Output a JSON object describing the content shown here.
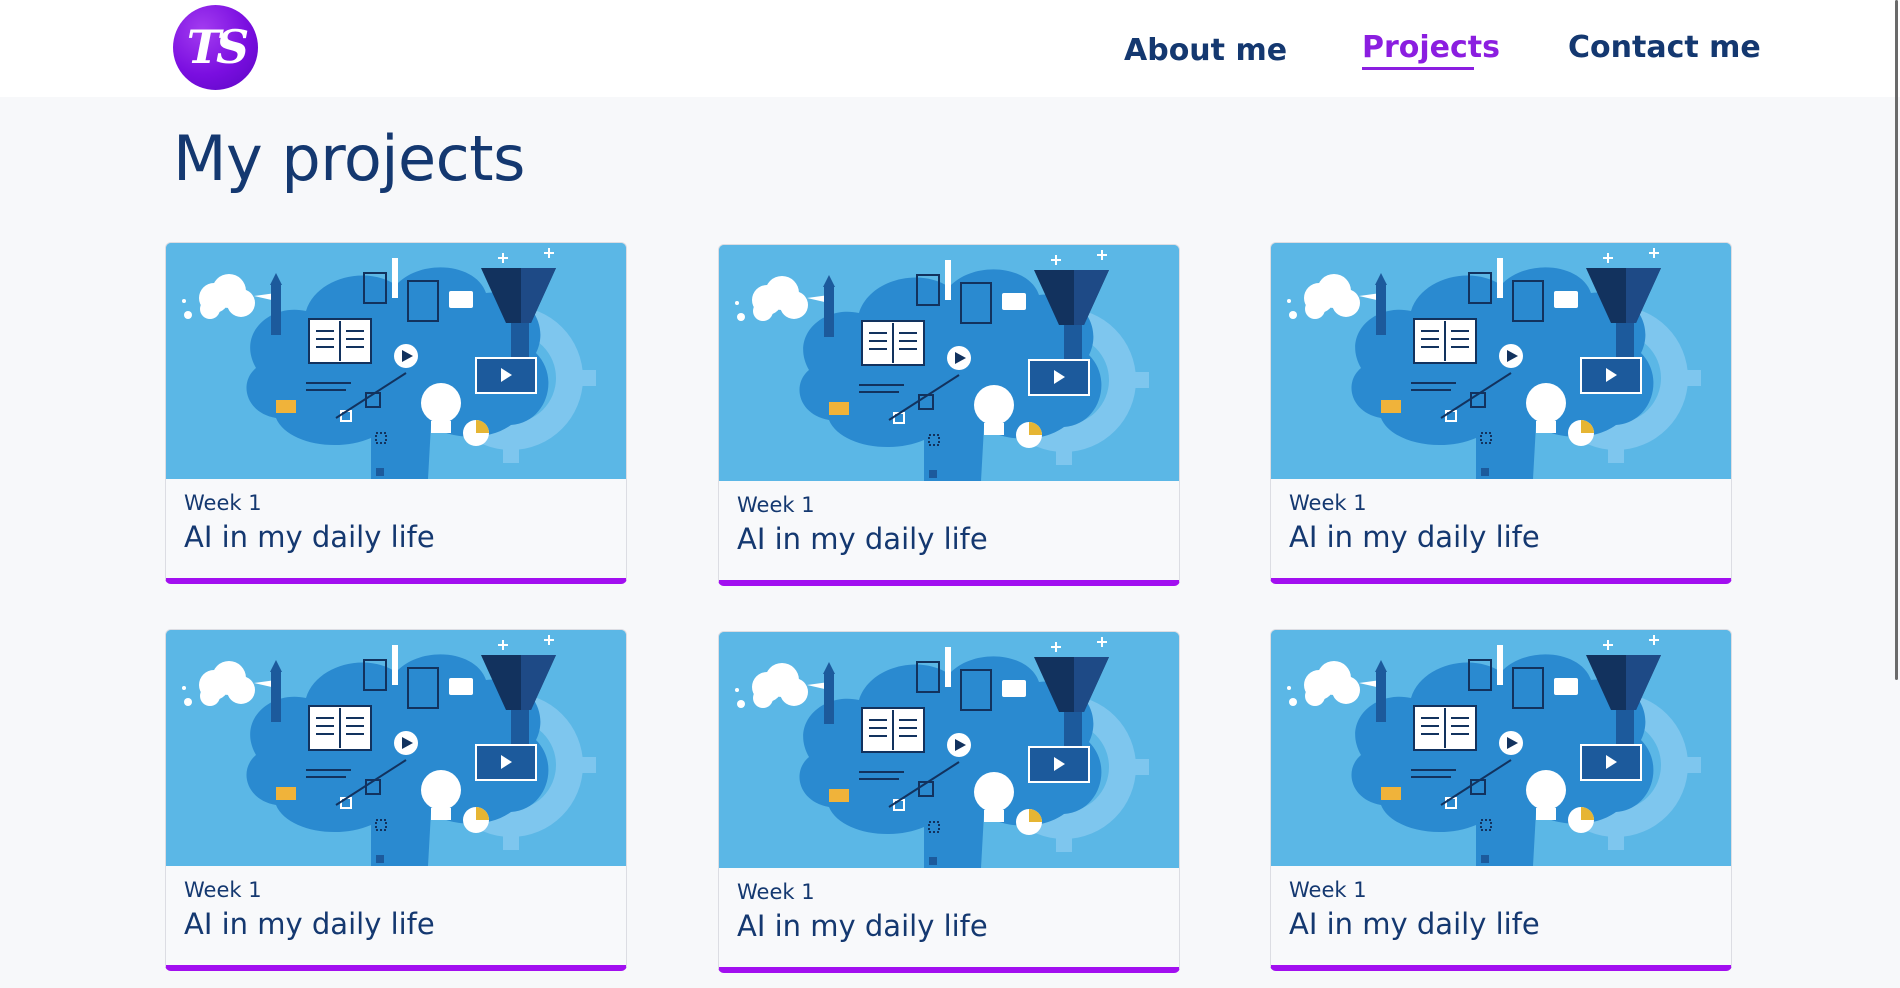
{
  "brand": {
    "logo_text": "TS",
    "logo_icon": "ts-monogram-logo"
  },
  "nav": {
    "about_label": "About me",
    "projects_label": "Projects",
    "contact_label": "Contact me",
    "active": "Projects"
  },
  "main": {
    "title": "My projects",
    "cards": [
      {
        "week": "Week 1",
        "title": "AI in my daily life",
        "image": "ai-brain-illustration"
      },
      {
        "week": "Week 1",
        "title": "AI in my daily life",
        "image": "ai-brain-illustration"
      },
      {
        "week": "Week 1",
        "title": "AI in my daily life",
        "image": "ai-brain-illustration"
      },
      {
        "week": "Week 1",
        "title": "AI in my daily life",
        "image": "ai-brain-illustration"
      },
      {
        "week": "Week 1",
        "title": "AI in my daily life",
        "image": "ai-brain-illustration"
      },
      {
        "week": "Week 1",
        "title": "AI in my daily life",
        "image": "ai-brain-illustration"
      }
    ]
  },
  "colors": {
    "accent": "#8b1ee0",
    "card_border_accent": "#a20ff0",
    "text_primary": "#143870",
    "image_background": "#5bb7e6"
  }
}
